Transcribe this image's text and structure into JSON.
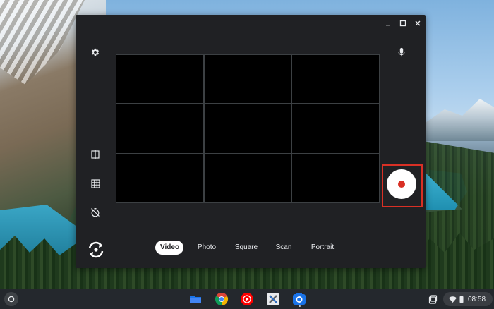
{
  "camera_app": {
    "modes": [
      {
        "label": "Video",
        "active": true
      },
      {
        "label": "Photo",
        "active": false
      },
      {
        "label": "Square",
        "active": false
      },
      {
        "label": "Scan",
        "active": false
      },
      {
        "label": "Portrait",
        "active": false
      }
    ],
    "icons": {
      "settings": "gear-icon",
      "microphone": "microphone-icon",
      "mirror": "mirror-icon",
      "grid": "grid-icon",
      "timer": "timer-off-icon",
      "switch_camera": "switch-camera-icon",
      "record": "record-icon"
    },
    "window_controls": [
      "minimize-icon",
      "maximize-icon",
      "close-icon"
    ]
  },
  "shelf": {
    "apps": [
      "files-app-icon",
      "chrome-app-icon",
      "youtube-music-app-icon",
      "tool-app-icon",
      "camera-app-icon"
    ],
    "clock": "08:58"
  },
  "colors": {
    "window_bg": "#202124",
    "record_red": "#d93025",
    "highlight_red": "#d93025",
    "active_tab_bg": "#ffffff"
  }
}
